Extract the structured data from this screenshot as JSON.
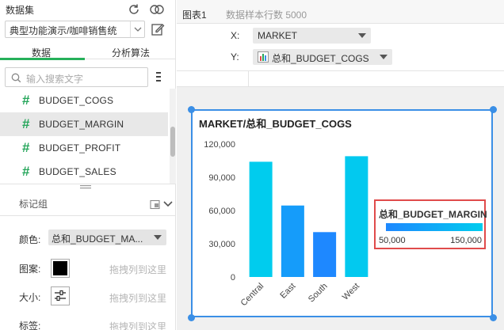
{
  "dataset": {
    "title": "数据集",
    "selected": "典型功能演示/咖啡销售统",
    "icons": [
      "refresh-icon",
      "dataset-link-icon",
      "edit-icon",
      "chevron-down-icon"
    ]
  },
  "tabs": [
    {
      "label": "数据",
      "active": true
    },
    {
      "label": "分析算法",
      "active": false
    }
  ],
  "search": {
    "placeholder": "输入搜索文字"
  },
  "fields": [
    {
      "name": "BUDGET_COGS",
      "type": "#",
      "selected": false
    },
    {
      "name": "BUDGET_MARGIN",
      "type": "#",
      "selected": true
    },
    {
      "name": "BUDGET_PROFIT",
      "type": "#",
      "selected": false
    },
    {
      "name": "BUDGET_SALES",
      "type": "#",
      "selected": false
    }
  ],
  "marks": {
    "title": "标记组",
    "color_label": "颜色:",
    "color_value": "总和_BUDGET_MA...",
    "pattern_label": "图案:",
    "size_label": "大小:",
    "tag_label": "标签:",
    "drop_hint": "拖拽列到这里"
  },
  "chart_header": {
    "name": "图表1",
    "sample": "数据样本行数 5000"
  },
  "axes": {
    "x_label": "X:",
    "x_value": "MARKET",
    "y_label": "Y:",
    "y_value": "总和_BUDGET_COGS"
  },
  "colors": {
    "accent": "#3b8fe6",
    "tab_active": "#26b05a",
    "field_icon": "#26a65b",
    "legend_border": "#e04b4b",
    "gradient_low": "#1e88ff",
    "gradient_high": "#00ccee"
  },
  "chart_data": {
    "type": "bar",
    "title": "MARKET/总和_BUDGET_COGS",
    "categories": [
      "Central",
      "East",
      "South",
      "West"
    ],
    "values": [
      104000,
      64500,
      40500,
      109000
    ],
    "color_values": [
      150000,
      80000,
      50000,
      145000
    ],
    "yticks": [
      "0",
      "30,000",
      "60,000",
      "90,000",
      "120,000"
    ],
    "ylim": [
      0,
      120000
    ],
    "legend": {
      "title": "总和_BUDGET_MARGIN",
      "min_label": "50,000",
      "max_label": "150,000",
      "range": [
        50000,
        150000
      ]
    }
  }
}
